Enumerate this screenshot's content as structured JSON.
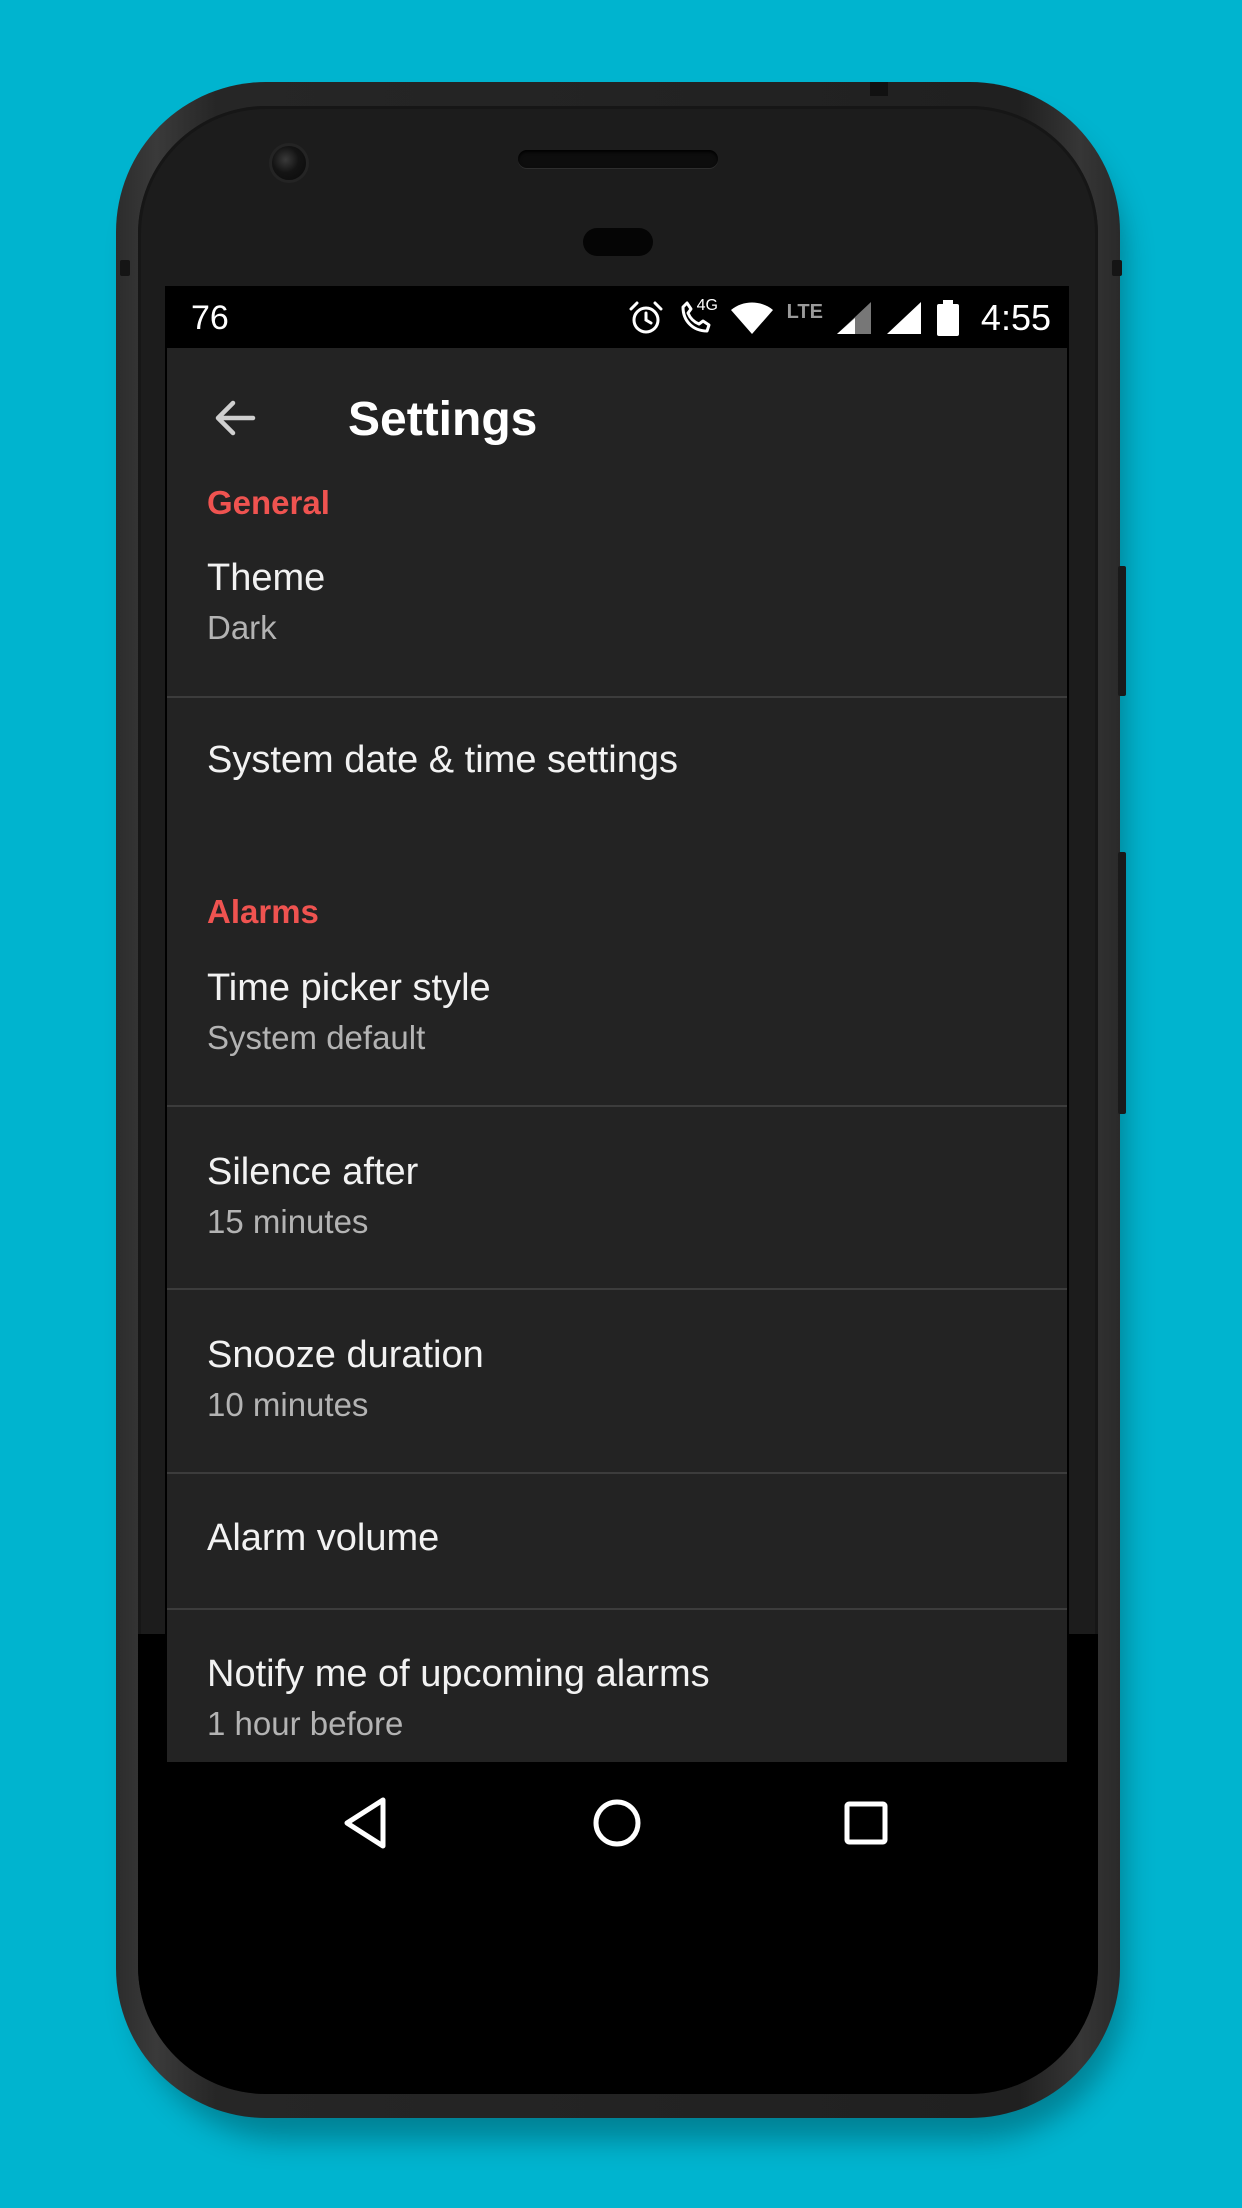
{
  "status_bar": {
    "left_text": "76",
    "time": "4:55",
    "network_label": "LTE",
    "call_label": "4G",
    "icons": [
      "alarm-icon",
      "volte-call-icon",
      "wifi-icon",
      "cell-signal-icon",
      "cell-signal-icon",
      "battery-icon"
    ]
  },
  "toolbar": {
    "title": "Settings",
    "back_icon": "arrow-back-icon"
  },
  "sections": [
    {
      "header": "General",
      "items": [
        {
          "title": "Theme",
          "summary": "Dark"
        },
        {
          "title": "System date & time settings",
          "summary": ""
        }
      ]
    },
    {
      "header": "Alarms",
      "items": [
        {
          "title": "Time picker style",
          "summary": "System default"
        },
        {
          "title": "Silence after",
          "summary": "15 minutes"
        },
        {
          "title": "Snooze duration",
          "summary": "10 minutes"
        },
        {
          "title": "Alarm volume",
          "summary": ""
        },
        {
          "title": "Notify me of upcoming alarms",
          "summary": "1 hour before"
        }
      ]
    }
  ],
  "nav_bar": {
    "icons": [
      "back-triangle-icon",
      "home-circle-icon",
      "recents-square-icon"
    ]
  },
  "colors": {
    "background": "#00b4cf",
    "app_background": "#232323",
    "accent": "#ef5350",
    "divider": "#3c3c3c"
  }
}
